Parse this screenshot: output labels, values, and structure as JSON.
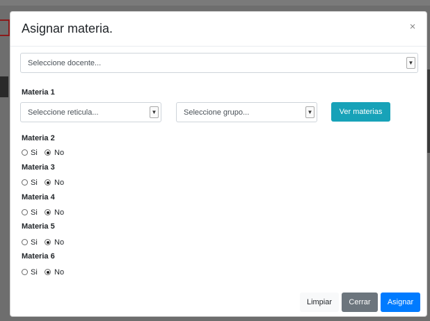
{
  "modal": {
    "title": "Asignar materia.",
    "close_glyph": "×",
    "docente_select": {
      "value": "Seleccione docente..."
    },
    "materia1": {
      "label": "Materia 1",
      "reticula_select": "Seleccione reticula...",
      "grupo_select": "Seleccione grupo...",
      "ver_button": "Ver materias"
    },
    "materias": [
      {
        "label": "Materia 2",
        "si": "Si",
        "no": "No",
        "selected": "No"
      },
      {
        "label": "Materia 3",
        "si": "Si",
        "no": "No",
        "selected": "No"
      },
      {
        "label": "Materia 4",
        "si": "Si",
        "no": "No",
        "selected": "No"
      },
      {
        "label": "Materia 5",
        "si": "Si",
        "no": "No",
        "selected": "No"
      },
      {
        "label": "Materia 6",
        "si": "Si",
        "no": "No",
        "selected": "No"
      }
    ],
    "footer": {
      "limpiar": "Limpiar",
      "cerrar": "Cerrar",
      "asignar": "Asignar"
    },
    "colors": {
      "info": "#17a2b8",
      "secondary": "#6c757d",
      "primary": "#007bff"
    }
  }
}
